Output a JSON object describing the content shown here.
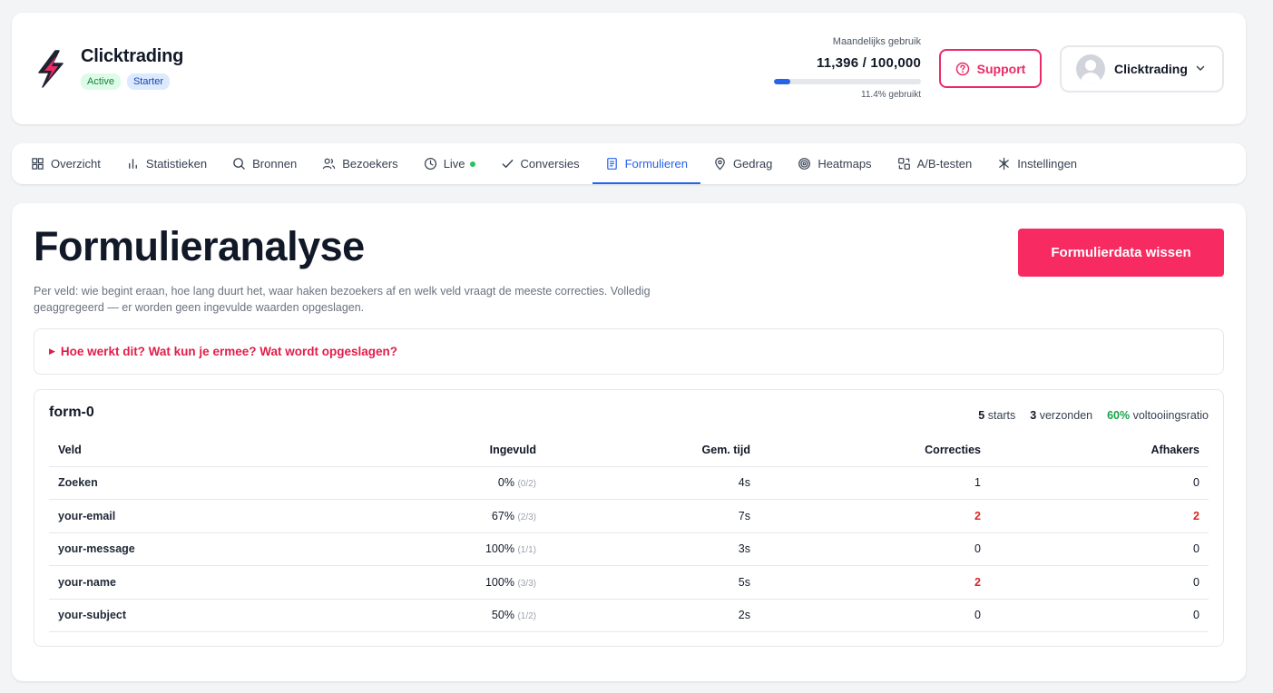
{
  "header": {
    "brand_name": "Clicktrading",
    "badges": {
      "status": "Active",
      "plan": "Starter"
    },
    "usage": {
      "label": "Maandelijks gebruik",
      "value": "11,396 / 100,000",
      "used_fraction": 0.114,
      "percent_text": "11.4% gebruikt"
    },
    "support_label": "Support",
    "user_name": "Clicktrading"
  },
  "nav": {
    "tabs": [
      {
        "label": "Overzicht",
        "icon": "grid-icon"
      },
      {
        "label": "Statistieken",
        "icon": "bar-chart-icon"
      },
      {
        "label": "Bronnen",
        "icon": "search-icon"
      },
      {
        "label": "Bezoekers",
        "icon": "users-icon"
      },
      {
        "label": "Live",
        "icon": "clock-icon"
      },
      {
        "label": "Conversies",
        "icon": "check-icon"
      },
      {
        "label": "Formulieren",
        "icon": "document-icon"
      },
      {
        "label": "Gedrag",
        "icon": "map-pin-icon"
      },
      {
        "label": "Heatmaps",
        "icon": "target-icon"
      },
      {
        "label": "A/B-testen",
        "icon": "ab-test-icon"
      },
      {
        "label": "Instellingen",
        "icon": "settings-icon"
      }
    ],
    "active_tab": "Formulieren"
  },
  "main": {
    "title": "Formulieranalyse",
    "description": "Per veld: wie begint eraan, hoe lang duurt het, waar haken bezoekers af en welk veld vraagt de meeste correcties. Volledig geaggregeerd — er worden geen ingevulde waarden opgeslagen.",
    "clear_button": "Formulierdata wissen",
    "details_summary": "Hoe werkt dit? Wat kun je ermee? Wat wordt opgeslagen?",
    "form": {
      "name": "form-0",
      "starts_value": "5",
      "starts_label": "starts",
      "sent_value": "3",
      "sent_label": "verzonden",
      "rate_value": "60%",
      "rate_label": "voltooiingsratio",
      "columns": [
        "Veld",
        "Ingevuld",
        "Gem. tijd",
        "Correcties",
        "Afhakers"
      ],
      "rows": [
        {
          "field": "Zoeken",
          "filled": "0%",
          "filled_frac": "(0/2)",
          "time": "4s",
          "corrections": "1",
          "dropoffs": "0"
        },
        {
          "field": "your-email",
          "filled": "67%",
          "filled_frac": "(2/3)",
          "time": "7s",
          "corrections": "2",
          "dropoffs": "2"
        },
        {
          "field": "your-message",
          "filled": "100%",
          "filled_frac": "(1/1)",
          "time": "3s",
          "corrections": "0",
          "dropoffs": "0"
        },
        {
          "field": "your-name",
          "filled": "100%",
          "filled_frac": "(3/3)",
          "time": "5s",
          "corrections": "2",
          "dropoffs": "0"
        },
        {
          "field": "your-subject",
          "filled": "50%",
          "filled_frac": "(1/2)",
          "time": "2s",
          "corrections": "0",
          "dropoffs": "0"
        }
      ]
    }
  },
  "colors": {
    "accent": "#ec2a66",
    "primary_blue": "#2563eb",
    "success": "#16a34a",
    "warning_red": "#dc2626"
  }
}
